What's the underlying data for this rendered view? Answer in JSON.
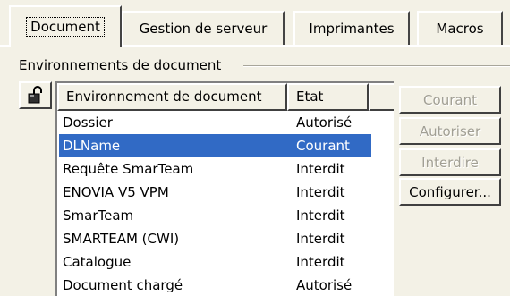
{
  "tabs": [
    {
      "label": "Document",
      "active": true
    },
    {
      "label": "Gestion de serveur",
      "active": false
    },
    {
      "label": "Imprimantes",
      "active": false
    },
    {
      "label": "Macros",
      "active": false
    }
  ],
  "group": {
    "label": "Environnements de document"
  },
  "list": {
    "headers": [
      "Environnement de document",
      "Etat"
    ],
    "rows": [
      {
        "name": "Dossier",
        "state": "Autorisé",
        "selected": false
      },
      {
        "name": "DLName",
        "state": "Courant",
        "selected": true
      },
      {
        "name": "Requête SmarTeam",
        "state": "Interdit",
        "selected": false
      },
      {
        "name": "ENOVIA V5 VPM",
        "state": "Interdit",
        "selected": false
      },
      {
        "name": "SmarTeam",
        "state": "Interdit",
        "selected": false
      },
      {
        "name": "SMARTEAM (CWI)",
        "state": "Interdit",
        "selected": false
      },
      {
        "name": "Catalogue",
        "state": "Interdit",
        "selected": false
      },
      {
        "name": "Document chargé",
        "state": "Autorisé",
        "selected": false
      }
    ]
  },
  "buttons": {
    "current": "Courant",
    "authorize": "Autoriser",
    "forbid": "Interdire",
    "configure": "Configurer..."
  },
  "icons": {
    "lock": "padlock-icon"
  },
  "colors": {
    "selection": "#316ac5",
    "face": "#f3f1e6",
    "disabled_text": "#a19f94"
  }
}
